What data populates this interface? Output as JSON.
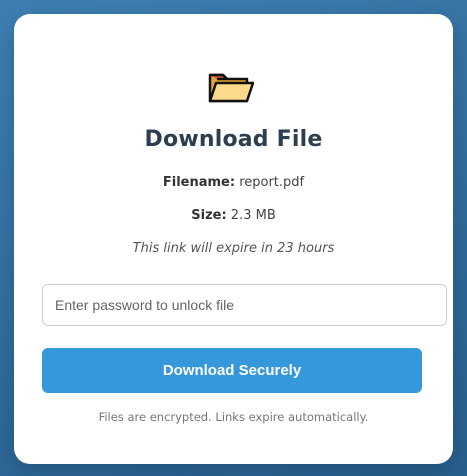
{
  "icon": "open-folder-icon",
  "title": "Download File",
  "file": {
    "filename_label": "Filename:",
    "filename_value": "report.pdf",
    "size_label": "Size:",
    "size_value": "2.3 MB",
    "expiry_text": "This link will expire in 23 hours"
  },
  "password": {
    "placeholder": "Enter password to unlock file",
    "value": ""
  },
  "download_button_label": "Download Securely",
  "footer_note": "Files are encrypted. Links expire automatically.",
  "colors": {
    "accent": "#3498db",
    "title": "#2c3e50",
    "background": "#2f6a9a"
  }
}
